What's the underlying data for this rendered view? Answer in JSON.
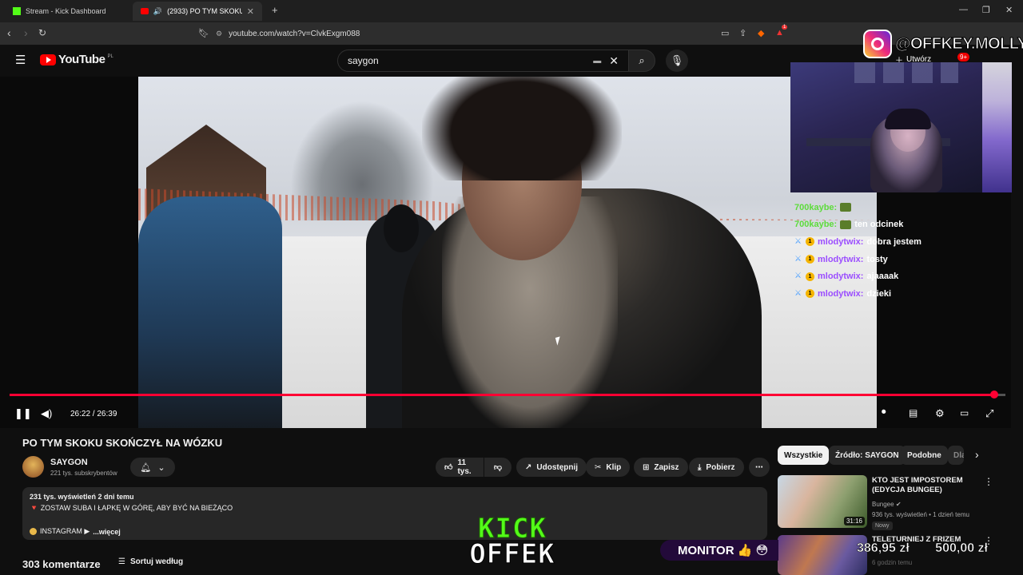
{
  "browser": {
    "tabs": [
      {
        "title": "Stream - Kick Dashboard",
        "active": false
      },
      {
        "title": "(2933) PO TYM SKOKU SKOŃ",
        "active": true
      }
    ],
    "url": "youtube.com/watch?v=ClvkExgm088",
    "ext_badge": "1"
  },
  "header": {
    "logo_text": "YouTube",
    "country": "PL",
    "search_value": "saygon",
    "create_label": "Utwórz",
    "notif_count": "9+"
  },
  "player": {
    "time": "26:22 / 26:39",
    "progress": 0.989
  },
  "overlay": {
    "instagram": "@OFFKEY.MOLLY",
    "chat": [
      {
        "user": "700kaybe:",
        "message": "",
        "color": "green",
        "badges": []
      },
      {
        "user": "700kaybe:",
        "message": "ten odcinek",
        "color": "green",
        "badges": []
      },
      {
        "user": "mlodytwix:",
        "message": "dobra jestem",
        "color": "purple",
        "badges": [
          "mod",
          "gold"
        ]
      },
      {
        "user": "mlodytwix:",
        "message": "tosty",
        "color": "purple",
        "badges": [
          "mod",
          "gold"
        ]
      },
      {
        "user": "mlodytwix:",
        "message": "ajaaaak",
        "color": "purple",
        "badges": [
          "mod",
          "gold"
        ]
      },
      {
        "user": "mlodytwix:",
        "message": "dzieki",
        "color": "purple",
        "badges": [
          "mod",
          "gold"
        ]
      }
    ],
    "kick_line1": "KICK",
    "kick_line2": "OFFEK",
    "monitor_label": "MONITOR 👍 😳",
    "goal_current": "386,95 zł",
    "goal_target": "500,00 zł"
  },
  "video": {
    "title": "PO TYM SKOKU SKOŃCZYŁ NA WÓZKU",
    "channel": "SAYGON",
    "subscribers": "221 tys. subskrybentów",
    "likes": "11 tys.",
    "share_label": "Udostępnij",
    "clip_label": "Klip",
    "save_label": "Zapisz",
    "download_label": "Pobierz",
    "views": "231 tys. wyświetleń  2 dni temu",
    "desc_line1": "🔻 ZOSTAW SUBA I ŁAPKĘ W GÓRĘ, ABY BYĆ NA BIEŻĄCO",
    "desc_line2": "INSTAGRAM ▶",
    "more_label": "...więcej",
    "comments_count": "303 komentarze",
    "sort_label": "Sortuj według"
  },
  "sidebar": {
    "chips": [
      "Wszystkie",
      "Źródło: SAYGON",
      "Podobne",
      "Dla"
    ],
    "recommendations": [
      {
        "title": "KTO JEST IMPOSTOREM (EDYCJA BUNGEE)",
        "channel": "Bungee",
        "meta": "936 tys. wyświetleń • 1 dzień temu",
        "badge": "Nowy",
        "duration": "31:16"
      },
      {
        "title": "TELETURNIEJ Z FRIZEM",
        "channel": "",
        "meta": "6 godzin temu",
        "badge": "",
        "duration": ""
      }
    ]
  }
}
